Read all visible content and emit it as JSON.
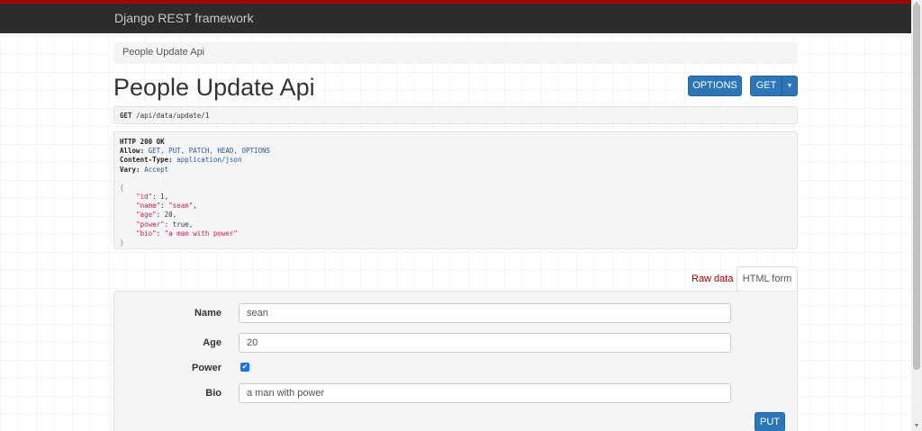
{
  "app": {
    "brand": "Django REST framework"
  },
  "breadcrumb": {
    "label": "People Update Api"
  },
  "page": {
    "title": "People Update Api"
  },
  "toolbar": {
    "options_label": "OPTIONS",
    "get_label": "GET",
    "caret": "▼"
  },
  "request": {
    "method": "GET",
    "path": "/api/data/update/1"
  },
  "response": {
    "status": "HTTP 200 OK",
    "headers": [
      {
        "key": "Allow:",
        "value": "GET, PUT, PATCH, HEAD, OPTIONS"
      },
      {
        "key": "Content-Type:",
        "value": "application/json"
      },
      {
        "key": "Vary:",
        "value": "Accept"
      }
    ],
    "body_open": "{",
    "body_close": "}",
    "body": [
      {
        "key": "\"id\"",
        "value": "1",
        "type": "num",
        "comma": ","
      },
      {
        "key": "\"name\"",
        "value": "\"sean\"",
        "type": "str",
        "comma": ","
      },
      {
        "key": "\"age\"",
        "value": "20",
        "type": "num",
        "comma": ","
      },
      {
        "key": "\"power\"",
        "value": "true",
        "type": "num",
        "comma": ","
      },
      {
        "key": "\"bio\"",
        "value": "\"a man with power\"",
        "type": "str",
        "comma": ""
      }
    ]
  },
  "tabs": {
    "raw_label": "Raw data",
    "html_label": "HTML form"
  },
  "form": {
    "name_label": "Name",
    "name_value": "sean",
    "age_label": "Age",
    "age_value": "20",
    "power_label": "Power",
    "power_checked": true,
    "bio_label": "Bio",
    "bio_value": "a man with power",
    "submit_label": "PUT"
  },
  "colors": {
    "navbar": "#2c2c2c",
    "accent": "#a30000",
    "primary": "#2c76b8"
  }
}
